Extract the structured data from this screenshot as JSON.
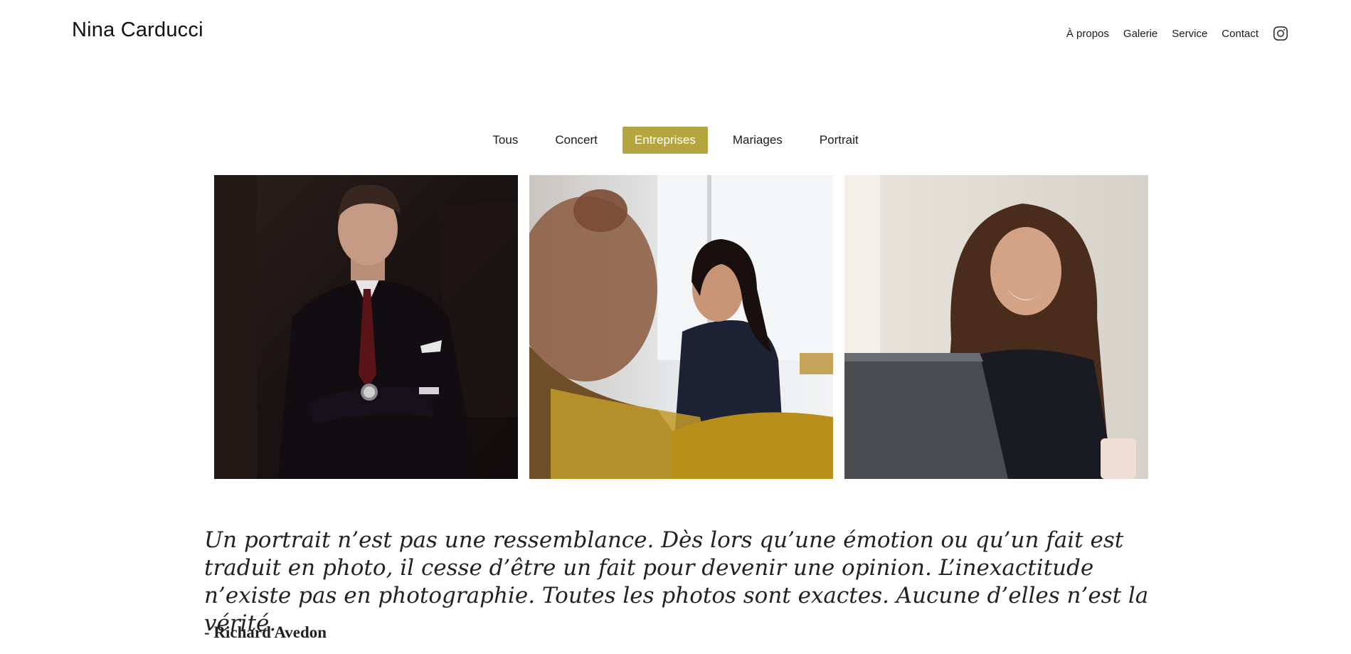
{
  "header": {
    "brand": "Nina Carducci",
    "nav": [
      "À propos",
      "Galerie",
      "Service",
      "Contact"
    ],
    "instagram_icon": "instagram-icon"
  },
  "filters": {
    "items": [
      "Tous",
      "Concert",
      "Entreprises",
      "Mariages",
      "Portrait"
    ],
    "active": "Entreprises",
    "accent_color": "#b5a53f"
  },
  "gallery": {
    "photos": [
      {
        "subject": "man-in-suit-photo"
      },
      {
        "subject": "smiling-woman-office-photo"
      },
      {
        "subject": "laughing-woman-laptop-photo"
      }
    ]
  },
  "quote": {
    "text": "Un portrait n’est pas une ressemblance. Dès lors qu’une émotion ou qu’un fait est traduit en photo, il cesse d’être un fait pour devenir une opinion. L’inexactitude n’existe pas en photographie. Toutes les photos sont exactes. Aucune d’elles n’est la vérité.",
    "author": "- Richard Avedon"
  }
}
